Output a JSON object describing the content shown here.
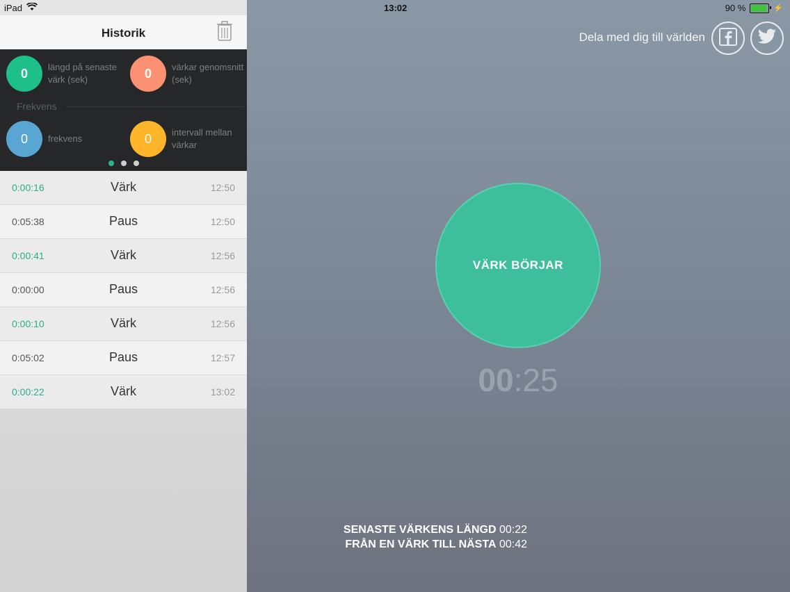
{
  "status": {
    "device": "iPad",
    "time": "13:02",
    "battery": "90 %"
  },
  "sidebar": {
    "title": "Historik",
    "stats": [
      {
        "value": "0",
        "label": "längd på senaste värk (sek)",
        "color": "#1fbf8a"
      },
      {
        "value": "0",
        "label": "värkar genomsnitt (sek)",
        "color": "#fa9173"
      },
      {
        "value": "0",
        "label": "frekvens",
        "color": "#5aa6d2"
      },
      {
        "value": "0",
        "label": "intervall mellan värkar",
        "color": "#ffb52a"
      }
    ],
    "frequency_title": "Frekvens",
    "history": [
      {
        "duration": "0:00:16",
        "type": "Värk",
        "time": "12:50"
      },
      {
        "duration": "0:05:38",
        "type": "Paus",
        "time": "12:50"
      },
      {
        "duration": "0:00:41",
        "type": "Värk",
        "time": "12:56"
      },
      {
        "duration": "0:00:00",
        "type": "Paus",
        "time": "12:56"
      },
      {
        "duration": "0:00:10",
        "type": "Värk",
        "time": "12:56"
      },
      {
        "duration": "0:05:02",
        "type": "Paus",
        "time": "12:57"
      },
      {
        "duration": "0:00:22",
        "type": "Värk",
        "time": "13:02"
      }
    ]
  },
  "main": {
    "share_text": "Dela med dig till världen",
    "start_button": "VÄRK BÖRJAR",
    "timer_min": "00",
    "timer_sep": ":",
    "timer_sec": "25",
    "last_length_label": "SENASTE VÄRKENS LÄNGD",
    "last_length_value": "00:22",
    "interval_label": "FRÅN EN VÄRK TILL NÄSTA",
    "interval_value": "00:42"
  },
  "colors": {
    "accent": "#3dbf9c"
  }
}
